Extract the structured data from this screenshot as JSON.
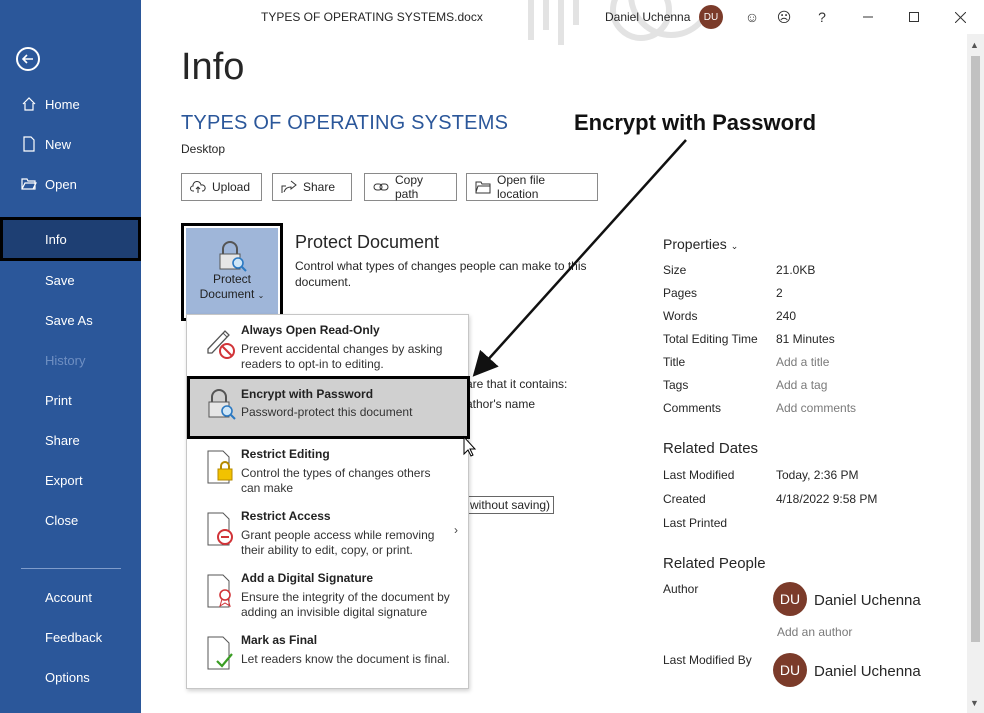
{
  "window": {
    "doc_title": "TYPES OF OPERATING SYSTEMS.docx",
    "user_name": "Daniel Uchenna",
    "user_initials": "DU"
  },
  "nav": {
    "items": [
      {
        "label": "Home"
      },
      {
        "label": "New"
      },
      {
        "label": "Open"
      },
      {
        "label": "Info"
      },
      {
        "label": "Save"
      },
      {
        "label": "Save As"
      },
      {
        "label": "History"
      },
      {
        "label": "Print"
      },
      {
        "label": "Share"
      },
      {
        "label": "Export"
      },
      {
        "label": "Close"
      },
      {
        "label": "Account"
      },
      {
        "label": "Feedback"
      },
      {
        "label": "Options"
      }
    ]
  },
  "main": {
    "page_title": "Info",
    "doc_heading": "TYPES OF OPERATING SYSTEMS",
    "doc_location": "Desktop",
    "actions": {
      "upload": "Upload",
      "share": "Share",
      "copy_path": "Copy path",
      "open_location": "Open file location"
    },
    "protect": {
      "tile_line1": "Protect",
      "tile_line2": "Document",
      "heading": "Protect Document",
      "description": "Control what types of changes people can make to this document."
    },
    "behind_text": {
      "line1": "are that it contains:",
      "line2": "athor's name",
      "line3": "d without saving)"
    }
  },
  "menu": {
    "items": [
      {
        "title": "Always Open Read-Only",
        "desc": "Prevent accidental changes by asking readers to opt-in to editing."
      },
      {
        "title": "Encrypt with Password",
        "desc": "Password-protect this document"
      },
      {
        "title": "Restrict Editing",
        "desc": "Control the types of changes others can make"
      },
      {
        "title": "Restrict Access",
        "desc": "Grant people access while removing their ability to edit, copy, or print."
      },
      {
        "title": "Add a Digital Signature",
        "desc": "Ensure the integrity of the document by adding an invisible digital signature"
      },
      {
        "title": "Mark as Final",
        "desc": "Let readers know the document is final."
      }
    ]
  },
  "properties": {
    "heading": "Properties",
    "rows": [
      {
        "label": "Size",
        "value": "21.0KB"
      },
      {
        "label": "Pages",
        "value": "2"
      },
      {
        "label": "Words",
        "value": "240"
      },
      {
        "label": "Total Editing Time",
        "value": "81 Minutes"
      },
      {
        "label": "Title",
        "value": "Add a title"
      },
      {
        "label": "Tags",
        "value": "Add a tag"
      },
      {
        "label": "Comments",
        "value": "Add comments"
      }
    ],
    "related_dates_heading": "Related Dates",
    "dates": [
      {
        "label": "Last Modified",
        "value": "Today, 2:36 PM"
      },
      {
        "label": "Created",
        "value": "4/18/2022 9:58 PM"
      },
      {
        "label": "Last Printed",
        "value": ""
      }
    ],
    "related_people_heading": "Related People",
    "author_label": "Author",
    "author_name": "Daniel Uchenna",
    "add_author": "Add an author",
    "last_modified_by_label": "Last Modified By",
    "last_modified_by_name": "Daniel Uchenna"
  },
  "annotation": {
    "text": "Encrypt with Password"
  },
  "colors": {
    "nav_bg": "#2b579a",
    "accent": "#2b579a",
    "avatar": "#7b3b2a"
  }
}
